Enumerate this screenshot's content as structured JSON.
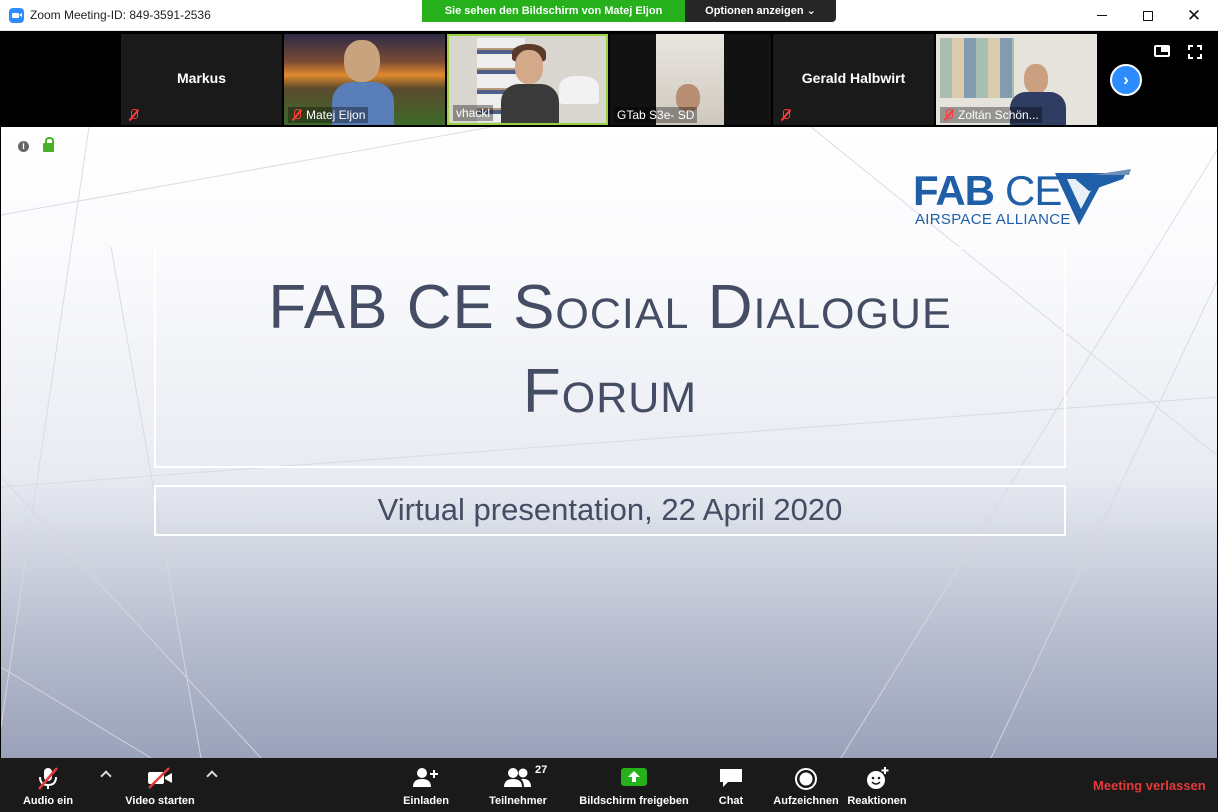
{
  "window": {
    "title": "Zoom Meeting-ID: 849-3591-2536",
    "share_banner": "Sie sehen den Bildschirm von Matej Eljon",
    "options_label": "Optionen anzeigen ⌄",
    "controls": {
      "minimize": "—",
      "maximize": "☐",
      "close": "✕"
    }
  },
  "participants": [
    {
      "name": "Markus",
      "video": false,
      "muted": true
    },
    {
      "name": "Matej Eljon",
      "video": true,
      "muted": true
    },
    {
      "name": "vhackl",
      "video": true,
      "muted": false
    },
    {
      "name": "GTab S3e- SD",
      "video": true,
      "muted": false
    },
    {
      "name": "Gerald Halbwirt",
      "video": false,
      "muted": true
    },
    {
      "name": "Zoltán Schön...",
      "video": true,
      "muted": true
    }
  ],
  "slide": {
    "logo_main_bold": "FAB",
    "logo_main_light": "CE",
    "logo_sub": "AIRSPACE ALLIANCE",
    "title_line1": "FAB CE Social Dialogue",
    "title_line2": "Forum",
    "subtitle": "Virtual presentation, 22 April 2020"
  },
  "toolbar": {
    "audio": "Audio ein",
    "video": "Video starten",
    "invite": "Einladen",
    "participants": "Teilnehmer",
    "participants_count": "27",
    "share": "Bildschirm freigeben",
    "chat": "Chat",
    "record": "Aufzeichnen",
    "reactions": "Reaktionen",
    "leave": "Meeting verlassen"
  },
  "colors": {
    "accent": "#2d8cff",
    "share_green": "#25b01c",
    "leave_red": "#e33b3b",
    "brand_blue": "#1f5fa8",
    "slide_text": "#444d63"
  }
}
